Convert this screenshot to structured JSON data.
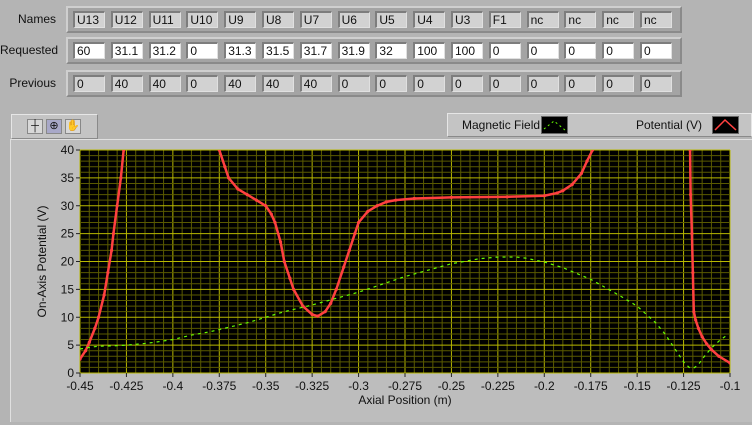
{
  "table": {
    "row_labels": {
      "names": "Names",
      "requested": "Requested",
      "previous": "Previous"
    },
    "names": [
      "U13",
      "U12",
      "U11",
      "U10",
      "U9",
      "U8",
      "U7",
      "U6",
      "U5",
      "U4",
      "U3",
      "F1",
      "nc",
      "nc",
      "nc",
      "nc"
    ],
    "requested": [
      "60",
      "31.1",
      "31.2",
      "0",
      "31.3",
      "31.5",
      "31.7",
      "31.9",
      "32",
      "100",
      "100",
      "0",
      "0",
      "0",
      "0",
      "0"
    ],
    "previous": [
      "0",
      "40",
      "40",
      "0",
      "40",
      "40",
      "40",
      "0",
      "0",
      "0",
      "0",
      "0",
      "0",
      "0",
      "0",
      "0"
    ]
  },
  "toolbar": {
    "icons": [
      "crosshair-icon",
      "zoom-icon",
      "pan-hand-icon"
    ]
  },
  "legend": {
    "magnetic": "Magnetic Field (T)",
    "potential": "Potential (V)"
  },
  "colors": {
    "potential": "#ff4040",
    "magnetic": "#66ff00",
    "grid_major": "#b8b800",
    "grid_minor": "#5a5a00",
    "plot_bg": "#000000"
  },
  "chart_data": {
    "type": "line",
    "xlabel": "Axial Position (m)",
    "ylabel": "On-Axis Potential (V)",
    "xlim": [
      -0.45,
      -0.1
    ],
    "ylim": [
      0,
      40
    ],
    "xticks": [
      "-0.45",
      "-0.425",
      "-0.4",
      "-0.375",
      "-0.35",
      "-0.325",
      "-0.3",
      "-0.275",
      "-0.25",
      "-0.225",
      "-0.2",
      "-0.175",
      "-0.15",
      "-0.125",
      "-0.1"
    ],
    "yticks": [
      "0",
      "5",
      "10",
      "15",
      "20",
      "25",
      "30",
      "35",
      "40"
    ],
    "grid": true,
    "series": [
      {
        "name": "Potential (V)",
        "segments": [
          [
            [
              -0.45,
              2.5
            ],
            [
              -0.447,
              4
            ],
            [
              -0.445,
              5.5
            ],
            [
              -0.442,
              8
            ],
            [
              -0.44,
              10
            ],
            [
              -0.437,
              14
            ],
            [
              -0.435,
              18
            ],
            [
              -0.433,
              22
            ],
            [
              -0.432,
              25
            ],
            [
              -0.43,
              30
            ],
            [
              -0.428,
              35
            ],
            [
              -0.4265,
              40
            ]
          ],
          [
            [
              -0.375,
              40
            ],
            [
              -0.372,
              37
            ],
            [
              -0.37,
              35
            ],
            [
              -0.365,
              33
            ],
            [
              -0.36,
              32
            ],
            [
              -0.355,
              31
            ],
            [
              -0.35,
              30
            ],
            [
              -0.347,
              28.5
            ],
            [
              -0.345,
              27
            ],
            [
              -0.342,
              23.5
            ],
            [
              -0.34,
              20
            ],
            [
              -0.337,
              17
            ],
            [
              -0.335,
              15
            ],
            [
              -0.33,
              12
            ],
            [
              -0.325,
              10.5
            ],
            [
              -0.322,
              10.2
            ],
            [
              -0.318,
              11
            ],
            [
              -0.315,
              12.5
            ],
            [
              -0.312,
              15
            ],
            [
              -0.308,
              19
            ],
            [
              -0.305,
              22
            ],
            [
              -0.302,
              25
            ],
            [
              -0.3,
              27
            ],
            [
              -0.295,
              29
            ],
            [
              -0.29,
              30
            ],
            [
              -0.285,
              30.7
            ],
            [
              -0.28,
              31
            ],
            [
              -0.27,
              31.3
            ],
            [
              -0.25,
              31.5
            ],
            [
              -0.22,
              31.6
            ],
            [
              -0.2,
              31.8
            ],
            [
              -0.193,
              32.3
            ],
            [
              -0.19,
              32.7
            ],
            [
              -0.185,
              33.8
            ],
            [
              -0.18,
              35.8
            ],
            [
              -0.177,
              38
            ],
            [
              -0.174,
              40
            ]
          ],
          [
            [
              -0.1215,
              40
            ],
            [
              -0.1212,
              32
            ],
            [
              -0.1205,
              25
            ],
            [
              -0.12,
              18
            ],
            [
              -0.1195,
              11
            ],
            [
              -0.1185,
              9.5
            ],
            [
              -0.117,
              8
            ],
            [
              -0.115,
              6.5
            ],
            [
              -0.1125,
              5.2
            ],
            [
              -0.11,
              4.2
            ],
            [
              -0.106,
              3
            ],
            [
              -0.1,
              1.8
            ]
          ]
        ]
      },
      {
        "name": "Magnetic Field (T)",
        "segments": [
          [
            [
              -0.45,
              4.3
            ],
            [
              -0.445,
              4.6
            ],
            [
              -0.44,
              4.8
            ],
            [
              -0.43,
              4.9
            ],
            [
              -0.425,
              5
            ],
            [
              -0.415,
              5.3
            ],
            [
              -0.41,
              5.5
            ],
            [
              -0.4,
              6
            ],
            [
              -0.39,
              6.8
            ],
            [
              -0.38,
              7.4
            ],
            [
              -0.375,
              7.8
            ],
            [
              -0.36,
              9
            ],
            [
              -0.35,
              10
            ],
            [
              -0.34,
              11
            ],
            [
              -0.325,
              12.2
            ],
            [
              -0.3,
              14.5
            ],
            [
              -0.275,
              17.3
            ],
            [
              -0.25,
              19.6
            ],
            [
              -0.235,
              20.5
            ],
            [
              -0.225,
              20.8
            ],
            [
              -0.215,
              20.8
            ],
            [
              -0.21,
              20.6
            ],
            [
              -0.2,
              19.9
            ],
            [
              -0.19,
              18.9
            ],
            [
              -0.175,
              16.8
            ],
            [
              -0.16,
              14
            ],
            [
              -0.15,
              12
            ],
            [
              -0.14,
              9
            ],
            [
              -0.135,
              7
            ],
            [
              -0.13,
              4.5
            ],
            [
              -0.125,
              2
            ],
            [
              -0.122,
              1
            ],
            [
              -0.1195,
              0.9
            ],
            [
              -0.117,
              1.5
            ],
            [
              -0.115,
              2.5
            ],
            [
              -0.11,
              4.5
            ],
            [
              -0.105,
              6
            ],
            [
              -0.1015,
              6.8
            ]
          ]
        ]
      }
    ]
  }
}
